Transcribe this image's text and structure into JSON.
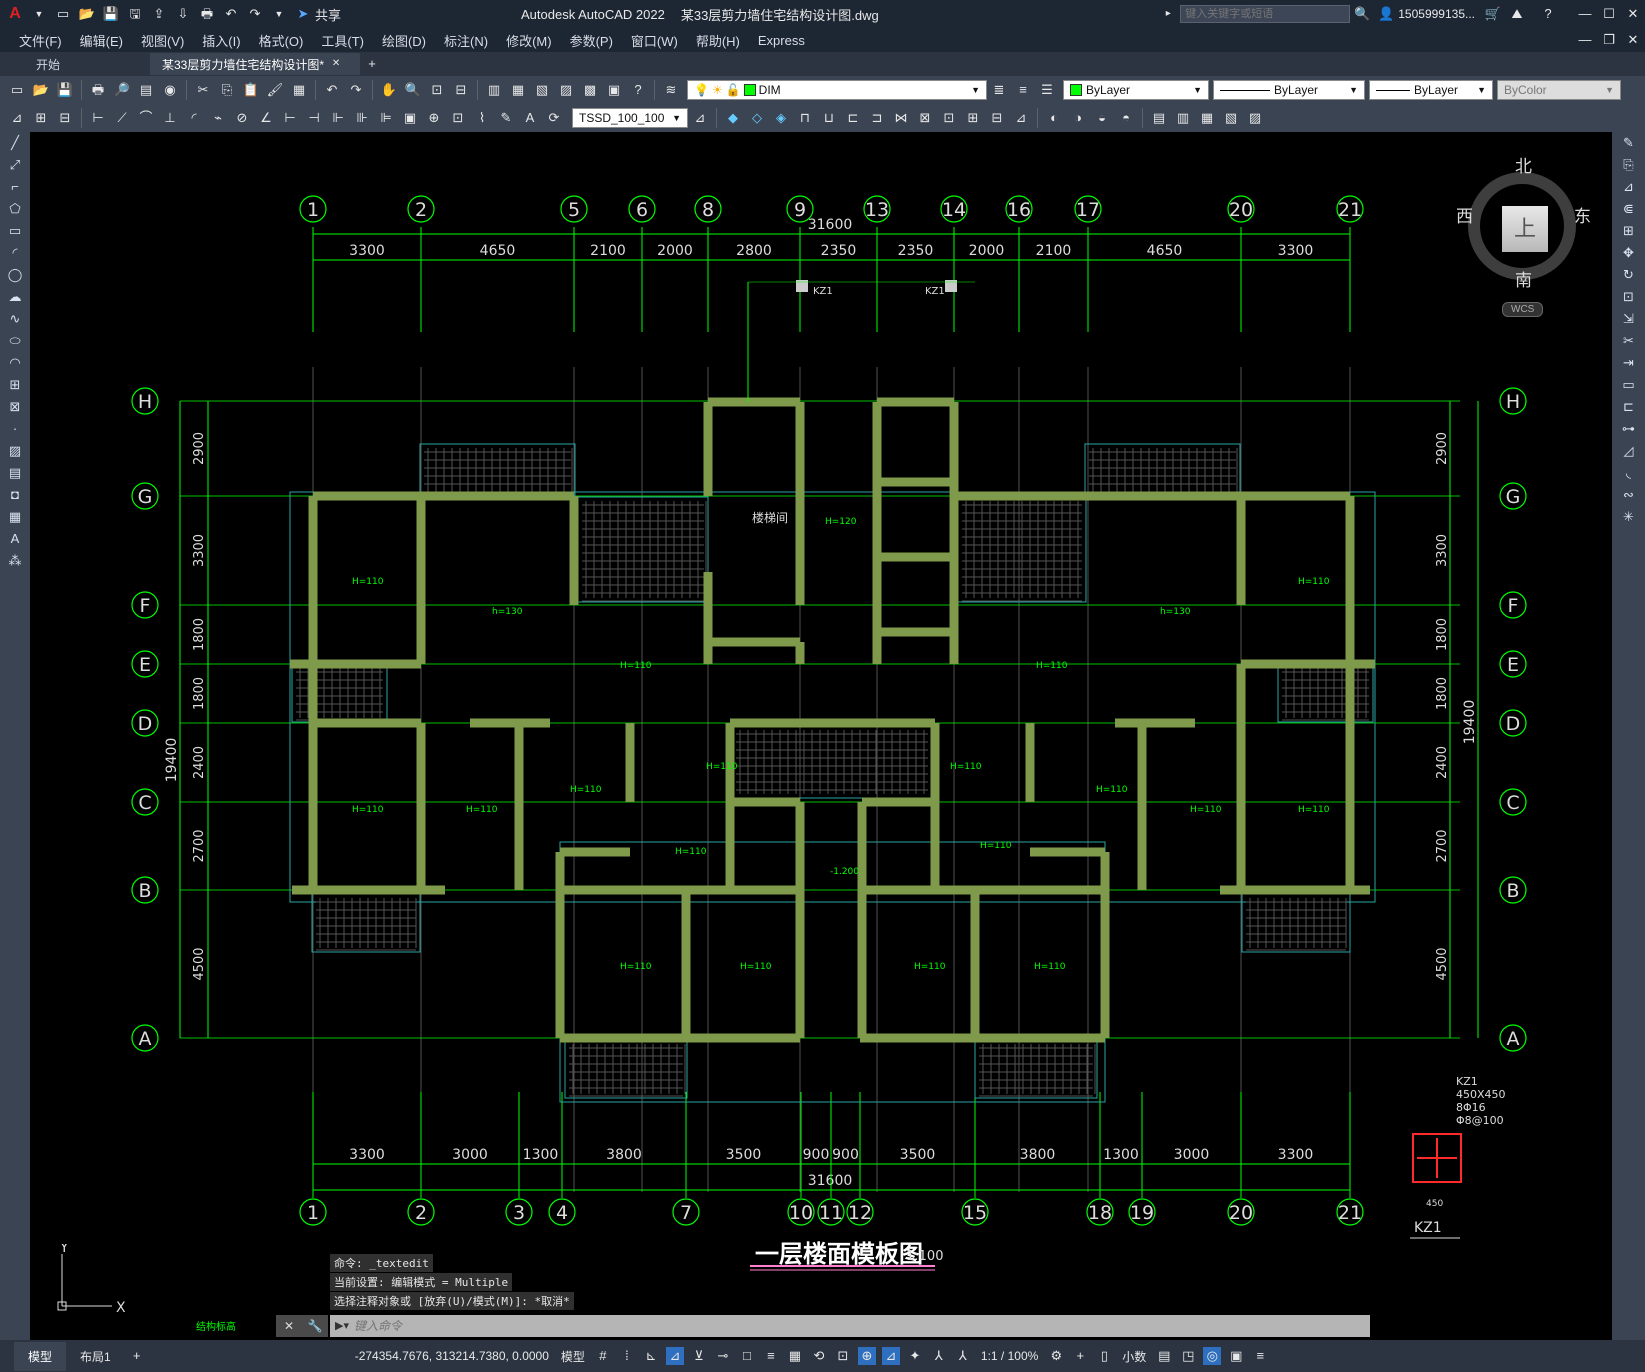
{
  "app": {
    "title": "Autodesk AutoCAD 2022",
    "file": "某33层剪力墙住宅结构设计图.dwg",
    "share_label": "共享",
    "search_placeholder": "键入关键字或短语",
    "user": "1505999135...",
    "window_controls": [
      "minimize-icon",
      "maximize-icon",
      "close-icon"
    ]
  },
  "menu": [
    "文件(F)",
    "编辑(E)",
    "视图(V)",
    "插入(I)",
    "格式(O)",
    "工具(T)",
    "绘图(D)",
    "标注(N)",
    "修改(M)",
    "参数(P)",
    "窗口(W)",
    "帮助(H)",
    "Express"
  ],
  "tabs": [
    {
      "label": "开始",
      "active": false
    },
    {
      "label": "某33层剪力墙住宅结构设计图*",
      "active": true
    }
  ],
  "toolbar1": {
    "layer": "DIM",
    "color": "ByLayer",
    "linetype": "ByLayer",
    "lineweight": "ByLayer",
    "plotstyle": "ByColor"
  },
  "toolbar2": {
    "dimstyle": "TSSD_100_100"
  },
  "viewcube": {
    "north": "北",
    "south": "南",
    "east": "东",
    "west": "西",
    "face": "上",
    "wcs": "WCS"
  },
  "drawing": {
    "title": "一层楼面模板图",
    "scale": "1:100",
    "top_axes": [
      "1",
      "2",
      "5",
      "6",
      "8",
      "9",
      "13",
      "14",
      "16",
      "17",
      "20",
      "21"
    ],
    "bottom_axes": [
      "1",
      "2",
      "3",
      "4",
      "7",
      "10",
      "11",
      "12",
      "15",
      "18",
      "19",
      "20",
      "21"
    ],
    "row_axes": [
      "H",
      "G",
      "F",
      "E",
      "D",
      "C",
      "B",
      "A"
    ],
    "top_total": "31600",
    "top_dims": [
      "3300",
      "4650",
      "2100",
      "2000",
      "2800",
      "2350",
      "2350",
      "2000",
      "2100",
      "4650",
      "3300"
    ],
    "bottom_total": "31600",
    "bottom_dims": [
      "3300",
      "3000",
      "1300",
      "3800",
      "3500",
      "900",
      "900",
      "3500",
      "3800",
      "1300",
      "3000",
      "3300"
    ],
    "left_dims": [
      "2900",
      "3300",
      "1800",
      "1800",
      "2400",
      "2700",
      "4500"
    ],
    "left_total": "19400",
    "right_dims": [
      "2900",
      "3300",
      "1800",
      "1800",
      "2400",
      "2700",
      "4500"
    ],
    "right_total": "19400",
    "column": {
      "name": "KZ1",
      "size": "450X450",
      "rebar": "8Φ16",
      "stirrup": "Φ8@100",
      "dim": "450"
    },
    "labels": {
      "stair": "楼梯间",
      "h110": "H=110",
      "h120": "H=120",
      "h130": "h=130",
      "elev": "-1.200"
    }
  },
  "command": {
    "history": [
      "命令: _textedit",
      "当前设置: 编辑模式 = Multiple",
      "选择注释对象或 [放弃(U)/模式(M)]: *取消*"
    ],
    "placeholder": "键入命令"
  },
  "status": {
    "tabs": [
      "模型",
      "布局1"
    ],
    "coords": "-274354.7676, 313214.7380, 0.0000",
    "space": "模型",
    "scale": "1:1 / 100%",
    "units": "小数",
    "bottom_note": "结构标高"
  }
}
